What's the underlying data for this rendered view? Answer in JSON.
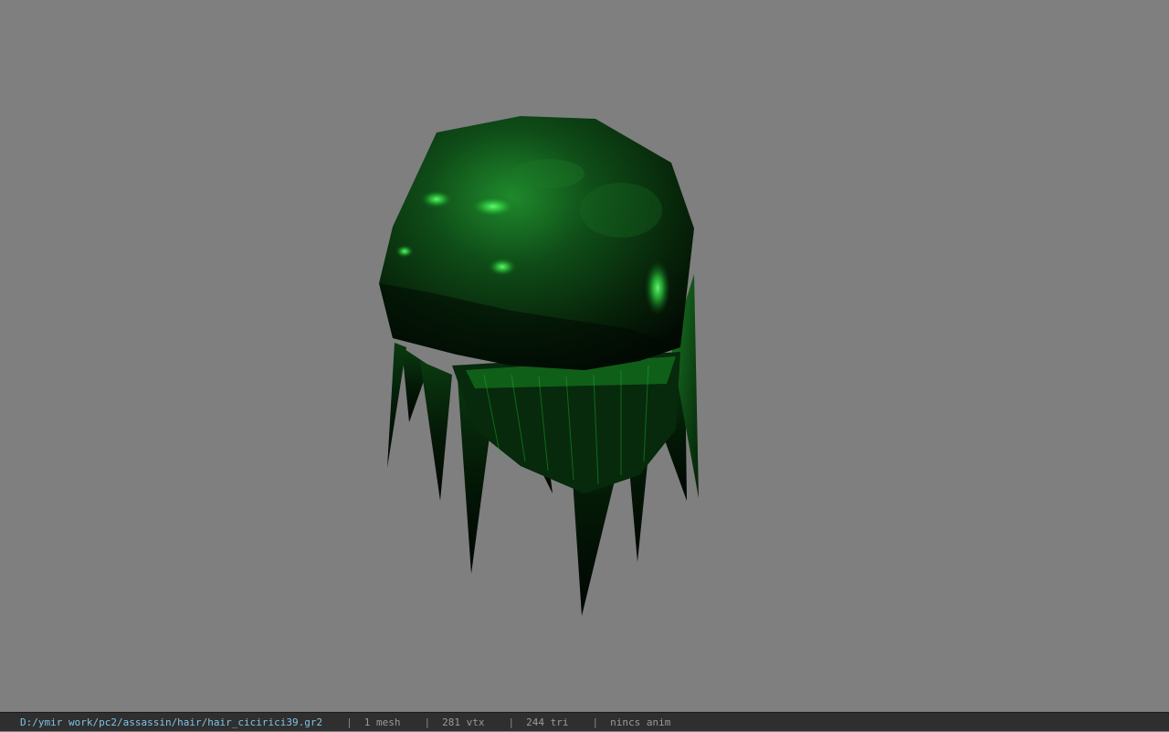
{
  "viewer": {
    "background_color": "#7f7f7f",
    "model_description_icon": "hair-mesh-icon",
    "model_colors": {
      "base": "#0b2a0f",
      "highlight": "#2fe04a",
      "dark": "#020a03"
    }
  },
  "status_bar": {
    "file_path": "D:/ymir work/pc2/assassin/hair/hair_cicirici39.gr2",
    "separator": "|",
    "mesh_count": "1 mesh",
    "vertex_count": "281 vtx",
    "triangle_count": "244 tri",
    "anim_status": "nincs anim"
  }
}
